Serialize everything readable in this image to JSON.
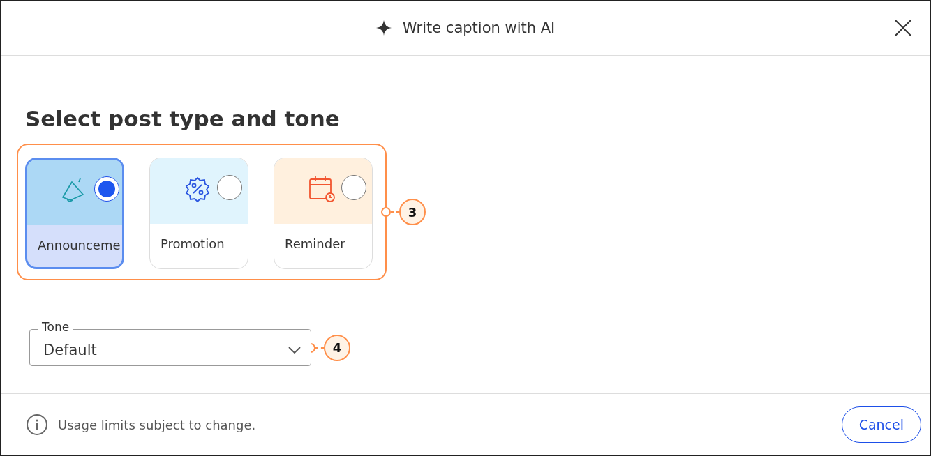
{
  "dialog": {
    "title": "Write caption with AI"
  },
  "heading": "Select post type and tone",
  "post_types": [
    {
      "label": "Announceme",
      "kind": "megaphone",
      "selected": true
    },
    {
      "label": "Promotion",
      "kind": "discount",
      "selected": false
    },
    {
      "label": "Reminder",
      "kind": "calendar",
      "selected": false
    }
  ],
  "callouts": [
    "3",
    "4"
  ],
  "tone": {
    "label": "Tone",
    "value": "Default"
  },
  "footer": {
    "note": "Usage limits subject to change.",
    "button": "Cancel"
  }
}
